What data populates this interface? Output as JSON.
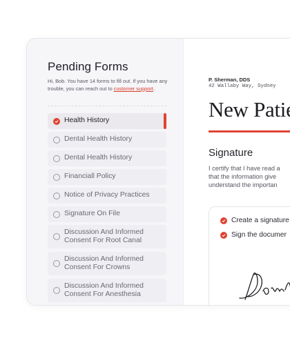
{
  "pending": {
    "title": "Pending Forms",
    "intro": "Hi, Bob. You have 14 forms to fill out. If you have any trouble, you can reach out to",
    "support_link": "customer support",
    "support_end": ".",
    "forms": [
      {
        "label": "Health History",
        "checked": true
      },
      {
        "label": "Dental Health History",
        "checked": false
      },
      {
        "label": "Dental Health History",
        "checked": false
      },
      {
        "label": "Financiall Policy",
        "checked": false
      },
      {
        "label": "Notice of Privacy Practices",
        "checked": false
      },
      {
        "label": "Signature On File",
        "checked": false
      },
      {
        "label": "Discussion And Informed Consent For Root Canal",
        "checked": false
      },
      {
        "label": "Discussion And Informed Consent For Crowns",
        "checked": false
      },
      {
        "label": "Discussion And Informed Consent For Anesthesia",
        "checked": false
      }
    ]
  },
  "document": {
    "doctor": "P. Sherman, DDS",
    "address": "42 Wallaby Way, Sydney",
    "title": "New Patie",
    "section": "Signature",
    "text_lines": [
      "I certify that I have read a",
      "that the information give",
      "understand the importan"
    ],
    "checks": [
      "Create a signature",
      "Sign the documer"
    ]
  },
  "colors": {
    "accent": "#e04333"
  }
}
